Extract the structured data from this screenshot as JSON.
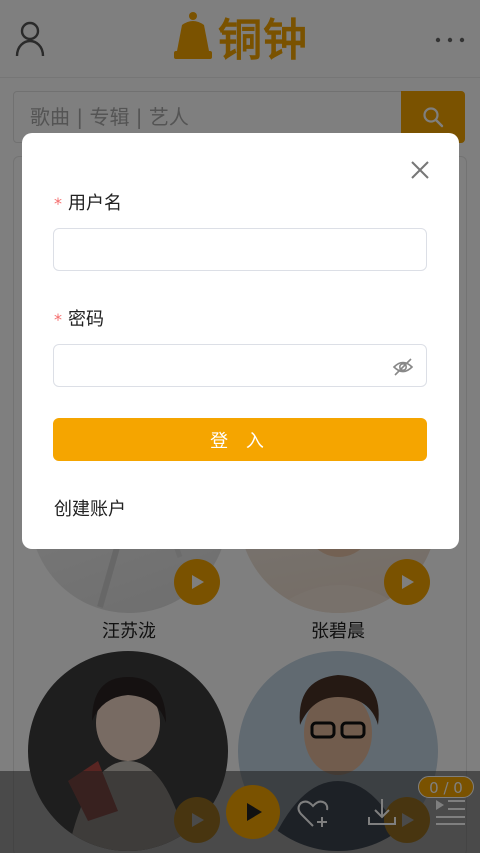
{
  "app": {
    "logo_text": "铜钟",
    "brand_color": "#f5a500"
  },
  "search": {
    "placeholder": "歌曲 | 专辑 | 艺人",
    "value": ""
  },
  "icons": {
    "user": "user-icon",
    "more": "more-icon",
    "search": "search-icon",
    "close": "close-icon",
    "eye": "eye-off-icon",
    "play": "play-icon",
    "favorite": "heart-plus-icon",
    "download": "download-icon",
    "playlist": "playlist-icon"
  },
  "artists": [
    {
      "name": "汪苏泷"
    },
    {
      "name": "张碧晨"
    },
    {
      "name": ""
    },
    {
      "name": ""
    }
  ],
  "player": {
    "queue_count": "0 / 0"
  },
  "login_modal": {
    "username_label": "用户名",
    "username_value": "",
    "password_label": "密码",
    "password_value": "",
    "required_mark": "*",
    "login_button": "登 入",
    "create_account": "创建账户"
  }
}
